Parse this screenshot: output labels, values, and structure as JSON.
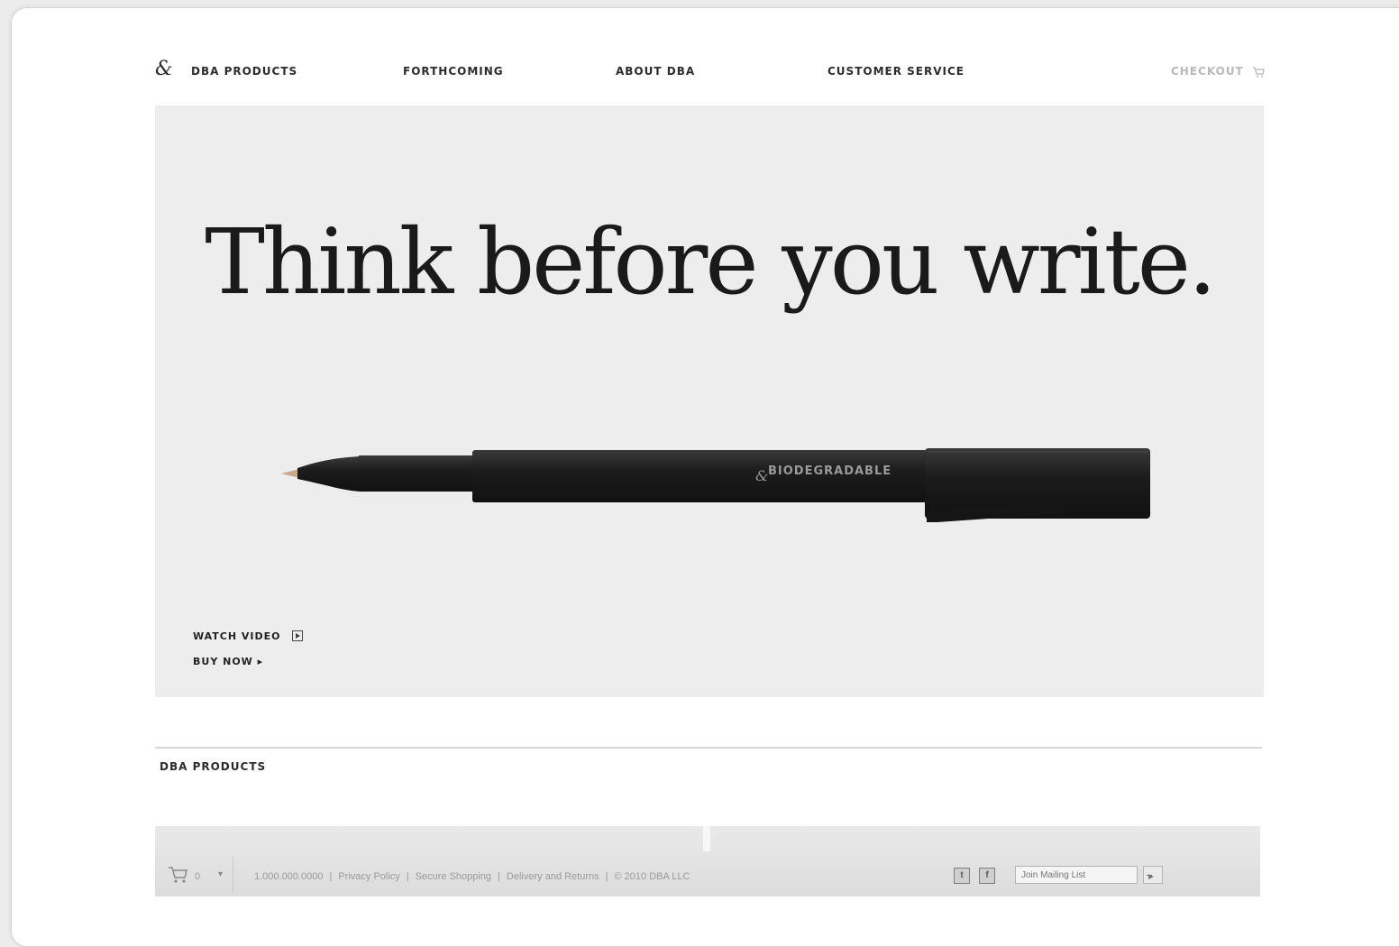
{
  "nav": {
    "items": [
      {
        "label": "DBA PRODUCTS"
      },
      {
        "label": "FORTHCOMING"
      },
      {
        "label": "ABOUT DBA"
      },
      {
        "label": "CUSTOMER SERVICE"
      }
    ],
    "checkout_label": "CHECKOUT"
  },
  "hero": {
    "headline": "Think before you write.",
    "pen_brand": "BIODEGRADABLE",
    "watch_video_label": "WATCH VIDEO",
    "buy_now_label": "BUY NOW ▸"
  },
  "products_section": {
    "title": "DBA PRODUCTS"
  },
  "footer": {
    "cart_count": "0",
    "dropdown_symbol": "▾",
    "links": [
      "1.000.000.0000",
      "Privacy Policy",
      "Secure Shopping",
      "Delivery and Returns",
      "© 2010 DBA LLC"
    ],
    "social": {
      "twitter": "t",
      "facebook": "f"
    },
    "mailing_placeholder": "Join Mailing List"
  },
  "colors": {
    "hero_background": "#ededed",
    "pen": "#1d1d1d",
    "checkout": "#b9b9b9"
  }
}
